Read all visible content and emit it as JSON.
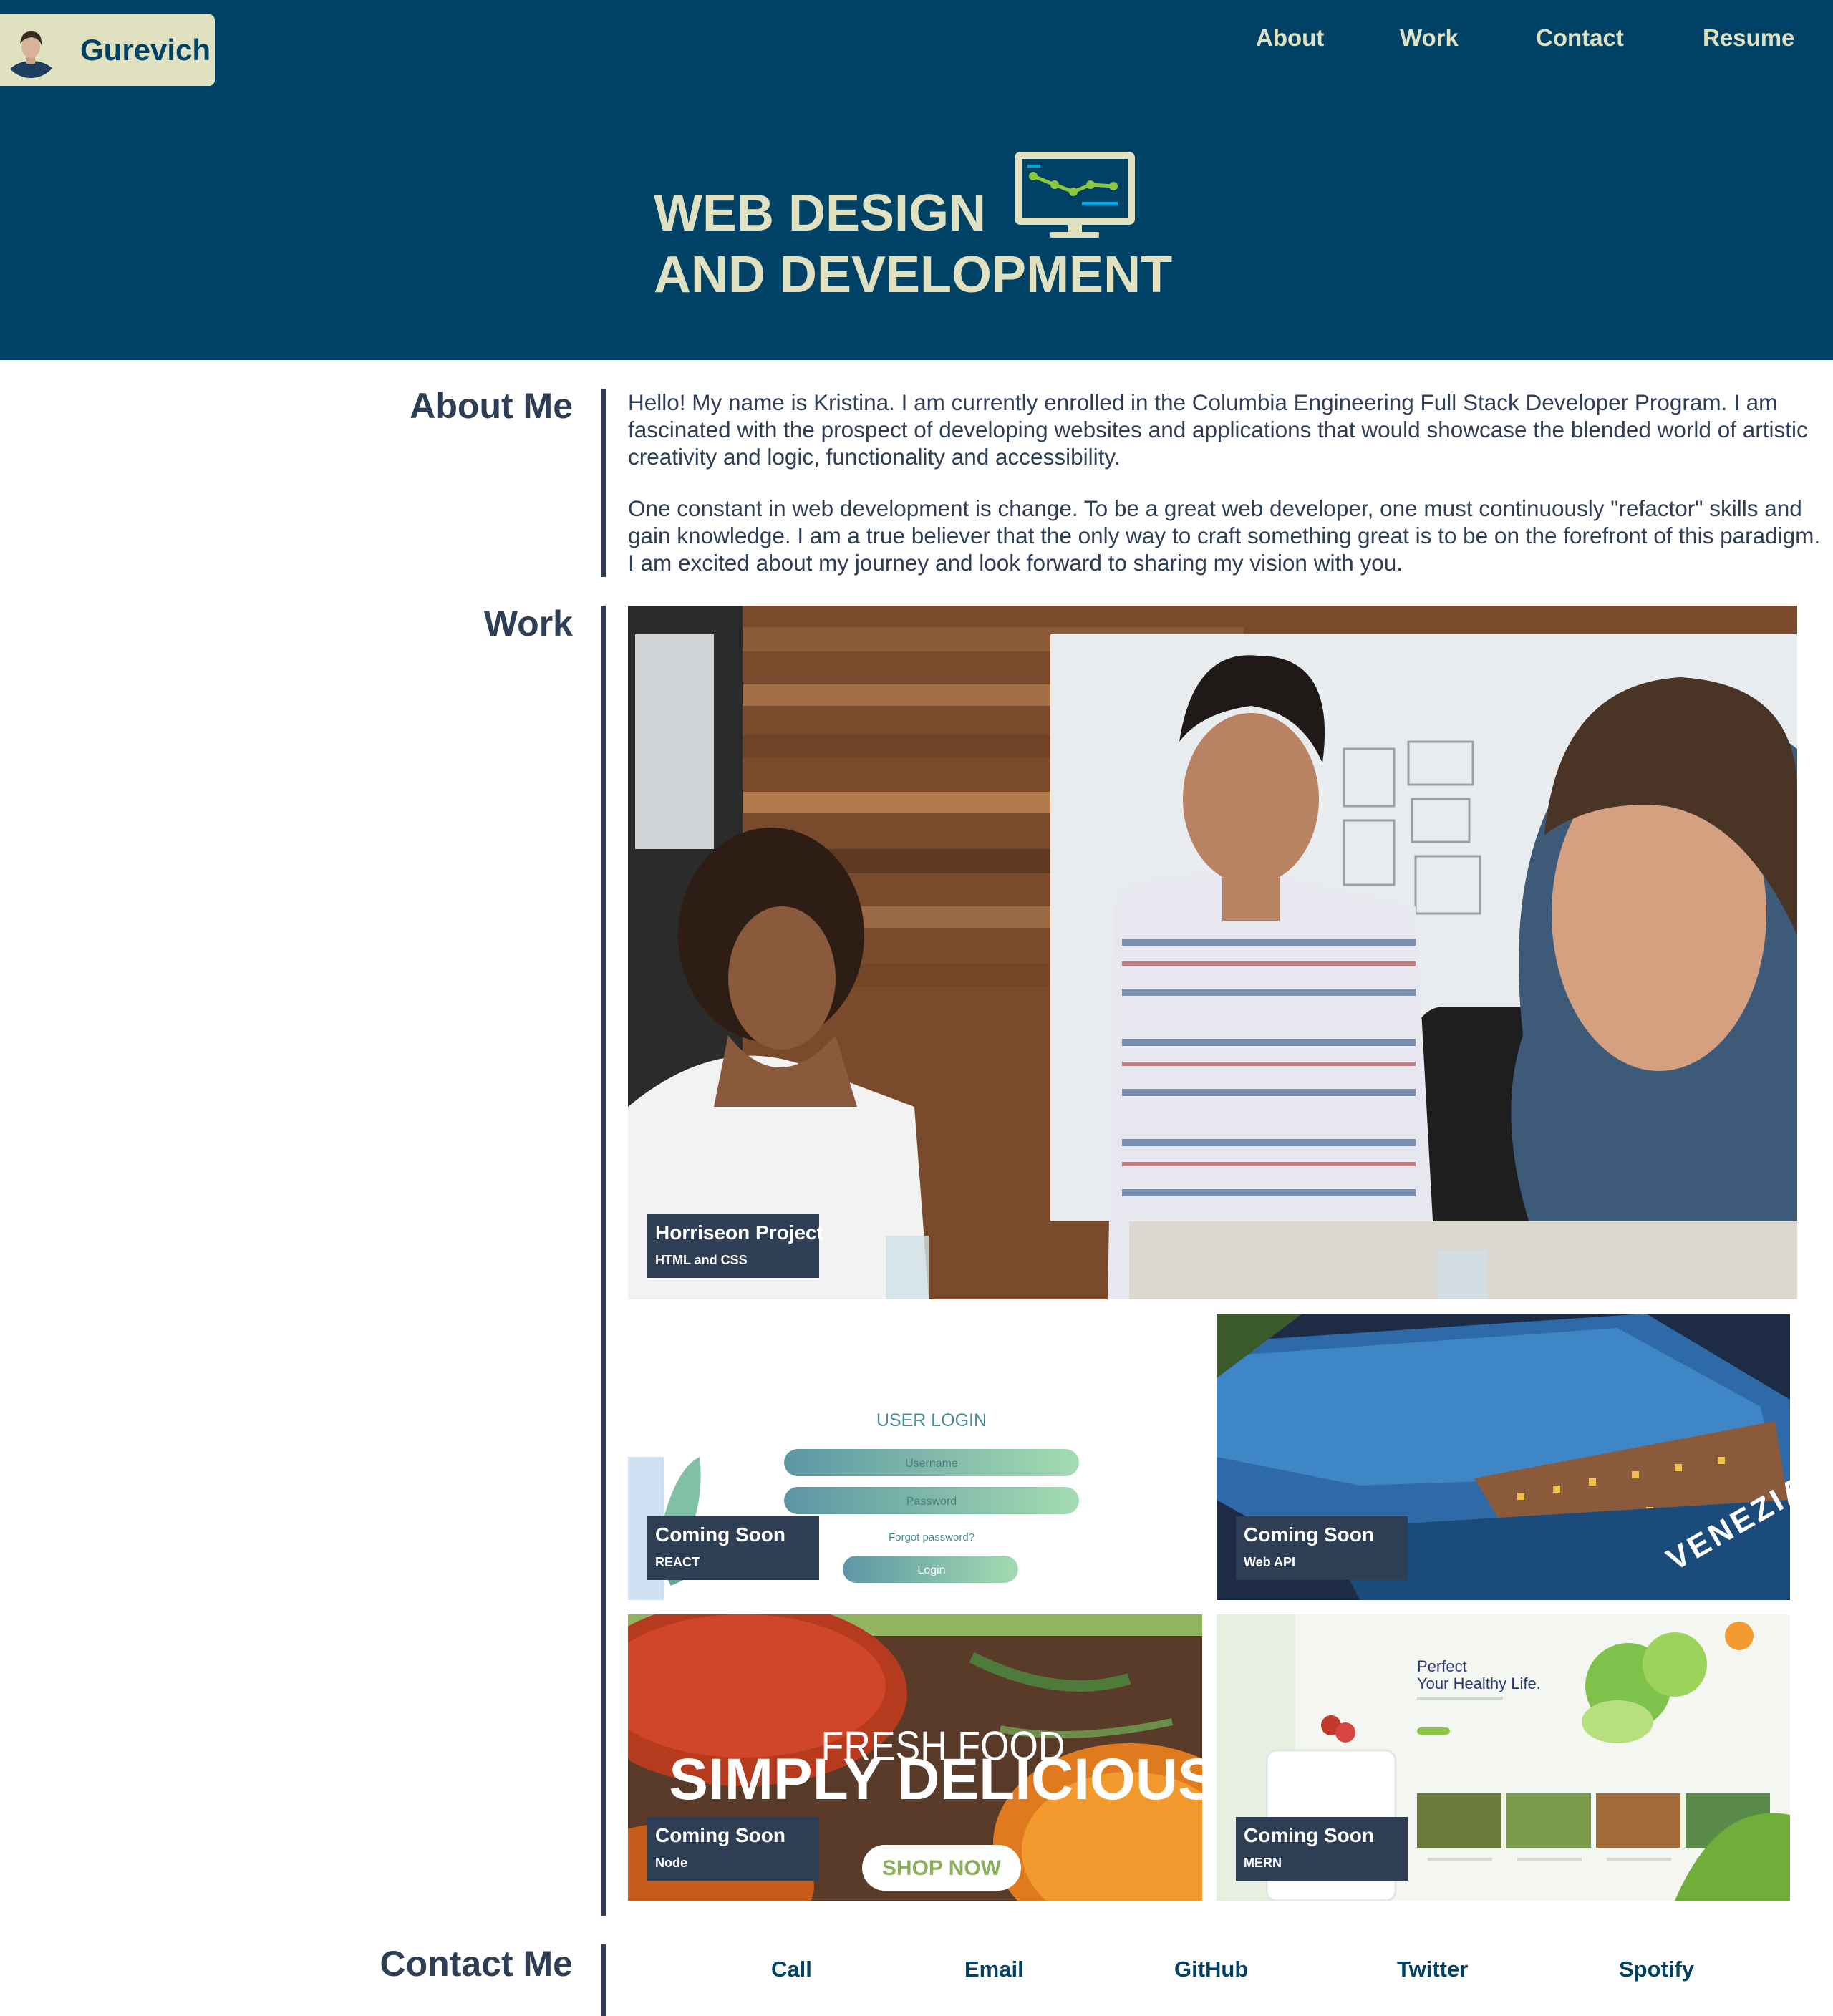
{
  "header": {
    "logo_name": "Gurevich",
    "nav": [
      "About",
      "Work",
      "Contact",
      "Resume"
    ],
    "hero_line1": "WEB DESIGN",
    "hero_line2": "AND DEVELOPMENT"
  },
  "about": {
    "title": "About Me",
    "paragraphs": [
      "Hello! My name is Kristina. I am currently enrolled in the Columbia Engineering Full Stack Developer Program. I am fascinated with the prospect of developing websites and applications that would showcase the blended world of artistic creativity and logic, functionality and accessibility.",
      "One constant in web development is change. To be a great web developer, one must continuously \"refactor\" skills and gain knowledge. I am a true believer that the only way to craft something great is to be on the forefront of this paradigm. I am excited about my journey and look forward to sharing my vision with you."
    ]
  },
  "work": {
    "title": "Work",
    "projects": [
      {
        "title": "Horriseon Project",
        "tech": "HTML and CSS"
      },
      {
        "title": "Coming Soon",
        "tech": "REACT",
        "image_text": {
          "heading": "USER LOGIN",
          "username": "Username",
          "password": "Password",
          "forgot": "Forgot password?",
          "button": "Login"
        }
      },
      {
        "title": "Coming Soon",
        "tech": "Web API",
        "image_text": {
          "word": "VENEZIA"
        }
      },
      {
        "title": "Coming Soon",
        "tech": "Node",
        "image_text": {
          "line1": "FRESH FOOD",
          "line2": "SIMPLY DELICIOUS",
          "button": "SHOP NOW"
        }
      },
      {
        "title": "Coming Soon",
        "tech": "MERN",
        "image_text": {
          "line1": "Perfect",
          "line2": "Your Healthy Life."
        }
      }
    ]
  },
  "contact": {
    "title": "Contact Me",
    "links": [
      "Call",
      "Email",
      "GitHub",
      "Twitter",
      "Spotify"
    ]
  },
  "colors": {
    "header_bg": "#004266",
    "accent_cream": "#dfe1c0",
    "text_navy": "#2d3e55"
  }
}
